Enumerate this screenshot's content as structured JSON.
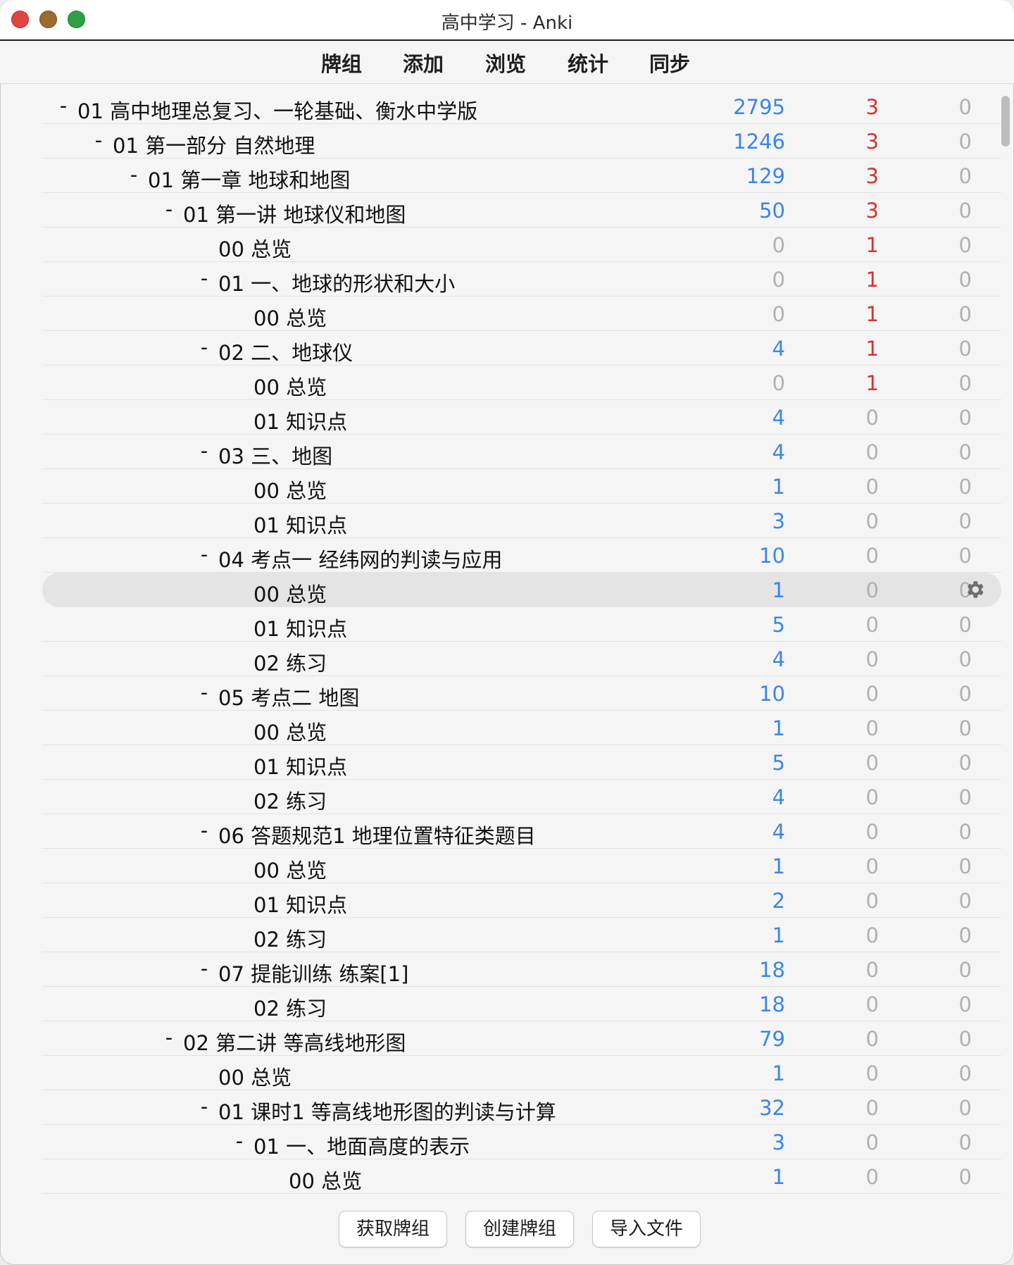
{
  "window": {
    "title": "高中学习 - Anki"
  },
  "toolbar": {
    "decks": "牌组",
    "add": "添加",
    "browse": "浏览",
    "stats": "统计",
    "sync": "同步"
  },
  "deck_rows": [
    {
      "level": 0,
      "collapse": "-",
      "name": "01 高中地理总复习、一轮基础、衡水中学版",
      "new": "2795",
      "learn": "3",
      "due": "0"
    },
    {
      "level": 1,
      "collapse": "-",
      "name": "01 第一部分 自然地理",
      "new": "1246",
      "learn": "3",
      "due": "0"
    },
    {
      "level": 2,
      "collapse": "-",
      "name": "01 第一章 地球和地图",
      "new": "129",
      "learn": "3",
      "due": "0"
    },
    {
      "level": 3,
      "collapse": "-",
      "name": "01 第一讲 地球仪和地图",
      "new": "50",
      "learn": "3",
      "due": "0"
    },
    {
      "level": 4,
      "collapse": "",
      "name": "00 总览",
      "new": "0",
      "learn": "1",
      "due": "0"
    },
    {
      "level": 4,
      "collapse": "-",
      "name": "01 一、地球的形状和大小",
      "new": "0",
      "learn": "1",
      "due": "0"
    },
    {
      "level": 5,
      "collapse": "",
      "name": "00 总览",
      "new": "0",
      "learn": "1",
      "due": "0"
    },
    {
      "level": 4,
      "collapse": "-",
      "name": "02 二、地球仪",
      "new": "4",
      "learn": "1",
      "due": "0"
    },
    {
      "level": 5,
      "collapse": "",
      "name": "00 总览",
      "new": "0",
      "learn": "1",
      "due": "0"
    },
    {
      "level": 5,
      "collapse": "",
      "name": "01 知识点",
      "new": "4",
      "learn": "0",
      "due": "0"
    },
    {
      "level": 4,
      "collapse": "-",
      "name": "03 三、地图",
      "new": "4",
      "learn": "0",
      "due": "0"
    },
    {
      "level": 5,
      "collapse": "",
      "name": "00 总览",
      "new": "1",
      "learn": "0",
      "due": "0"
    },
    {
      "level": 5,
      "collapse": "",
      "name": "01 知识点",
      "new": "3",
      "learn": "0",
      "due": "0"
    },
    {
      "level": 4,
      "collapse": "-",
      "name": "04 考点一 经纬网的判读与应用",
      "new": "10",
      "learn": "0",
      "due": "0"
    },
    {
      "level": 5,
      "collapse": "",
      "name": "00 总览",
      "new": "1",
      "learn": "0",
      "due": "0",
      "selected": true
    },
    {
      "level": 5,
      "collapse": "",
      "name": "01 知识点",
      "new": "5",
      "learn": "0",
      "due": "0"
    },
    {
      "level": 5,
      "collapse": "",
      "name": "02 练习",
      "new": "4",
      "learn": "0",
      "due": "0"
    },
    {
      "level": 4,
      "collapse": "-",
      "name": "05 考点二 地图",
      "new": "10",
      "learn": "0",
      "due": "0"
    },
    {
      "level": 5,
      "collapse": "",
      "name": "00 总览",
      "new": "1",
      "learn": "0",
      "due": "0"
    },
    {
      "level": 5,
      "collapse": "",
      "name": "01 知识点",
      "new": "5",
      "learn": "0",
      "due": "0"
    },
    {
      "level": 5,
      "collapse": "",
      "name": "02 练习",
      "new": "4",
      "learn": "0",
      "due": "0"
    },
    {
      "level": 4,
      "collapse": "-",
      "name": "06 答题规范1 地理位置特征类题目",
      "new": "4",
      "learn": "0",
      "due": "0"
    },
    {
      "level": 5,
      "collapse": "",
      "name": "00 总览",
      "new": "1",
      "learn": "0",
      "due": "0"
    },
    {
      "level": 5,
      "collapse": "",
      "name": "01 知识点",
      "new": "2",
      "learn": "0",
      "due": "0"
    },
    {
      "level": 5,
      "collapse": "",
      "name": "02 练习",
      "new": "1",
      "learn": "0",
      "due": "0"
    },
    {
      "level": 4,
      "collapse": "-",
      "name": "07 提能训练 练案[1]",
      "new": "18",
      "learn": "0",
      "due": "0"
    },
    {
      "level": 5,
      "collapse": "",
      "name": "02 练习",
      "new": "18",
      "learn": "0",
      "due": "0"
    },
    {
      "level": 3,
      "collapse": "-",
      "name": "02 第二讲 等高线地形图",
      "new": "79",
      "learn": "0",
      "due": "0"
    },
    {
      "level": 4,
      "collapse": "",
      "name": "00 总览",
      "new": "1",
      "learn": "0",
      "due": "0"
    },
    {
      "level": 4,
      "collapse": "-",
      "name": "01 课时1 等高线地形图的判读与计算",
      "new": "32",
      "learn": "0",
      "due": "0"
    },
    {
      "level": 5,
      "collapse": "-",
      "name": "01 一、地面高度的表示",
      "new": "3",
      "learn": "0",
      "due": "0"
    },
    {
      "level": 6,
      "collapse": "",
      "name": "00 总览",
      "new": "1",
      "learn": "0",
      "due": "0"
    }
  ],
  "bottom_buttons": {
    "get_shared": "获取牌组",
    "create_deck": "创建牌组",
    "import_file": "导入文件"
  },
  "colors": {
    "new_nonzero": "#3a86e8",
    "learn_nonzero": "#d9322d",
    "zero": "#b0b0b0"
  }
}
